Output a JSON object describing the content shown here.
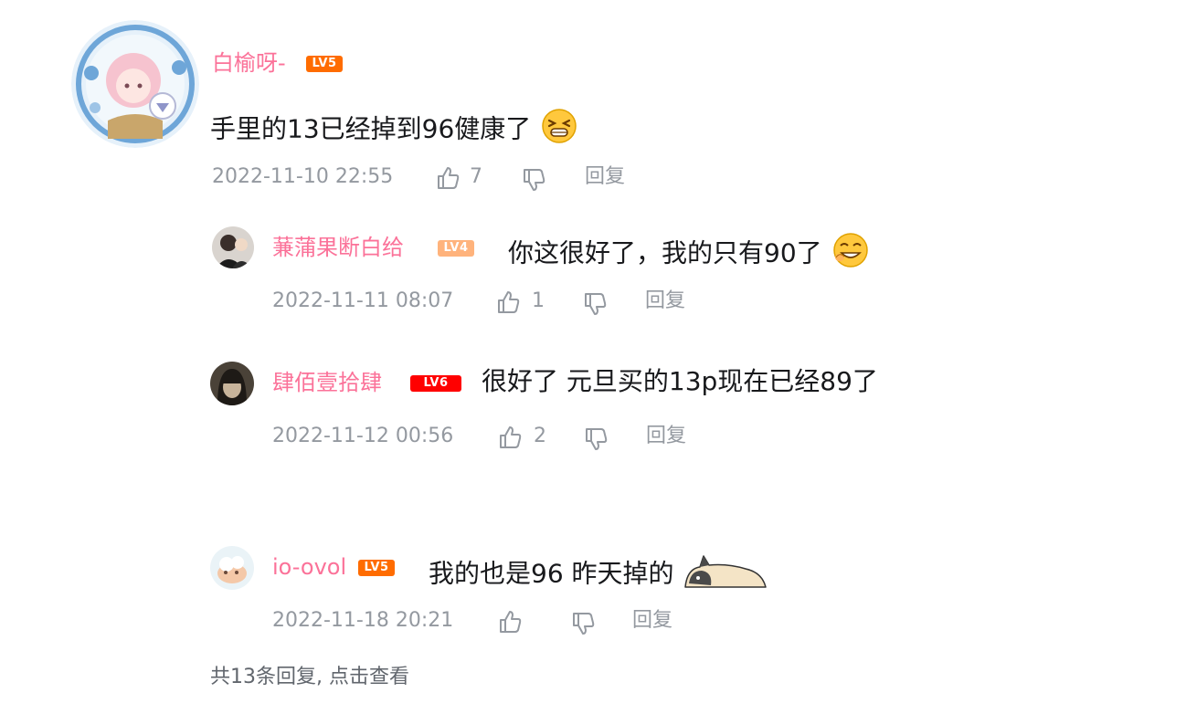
{
  "main_comment": {
    "username": "白榆呀-",
    "level": "LV5",
    "level_color": "#ff6c00",
    "text": "手里的13已经掉到96健康了",
    "emoji": "grinning-squint-emoji",
    "time": "2022-11-10 22:55",
    "likes": "7",
    "reply_label": "回复"
  },
  "replies": [
    {
      "username": "蒹蒲果断白给",
      "level": "LV4",
      "level_color": "#ffb37c",
      "text": "你这很好了，我的只有90了",
      "emoji": "crying-laugh-emoji",
      "time": "2022-11-11 08:07",
      "likes": "1",
      "reply_label": "回复"
    },
    {
      "username": "肆佰壹拾肆",
      "level": "LV6",
      "level_color": "#ff0000",
      "text": "很好了 元旦买的13p现在已经89了",
      "time": "2022-11-12 00:56",
      "likes": "2",
      "reply_label": "回复"
    },
    {
      "username": "io-ovol",
      "level": "LV5",
      "level_color": "#ff6c00",
      "text": "我的也是96 昨天掉的",
      "emoji": "lying-dog-sticker",
      "time": "2022-11-18 20:21",
      "likes": "",
      "reply_label": "回复"
    }
  ],
  "view_more": "共13条回复, 点击查看",
  "colors": {
    "username": "#fb7299",
    "meta": "#9499a0",
    "text": "#18191c"
  }
}
